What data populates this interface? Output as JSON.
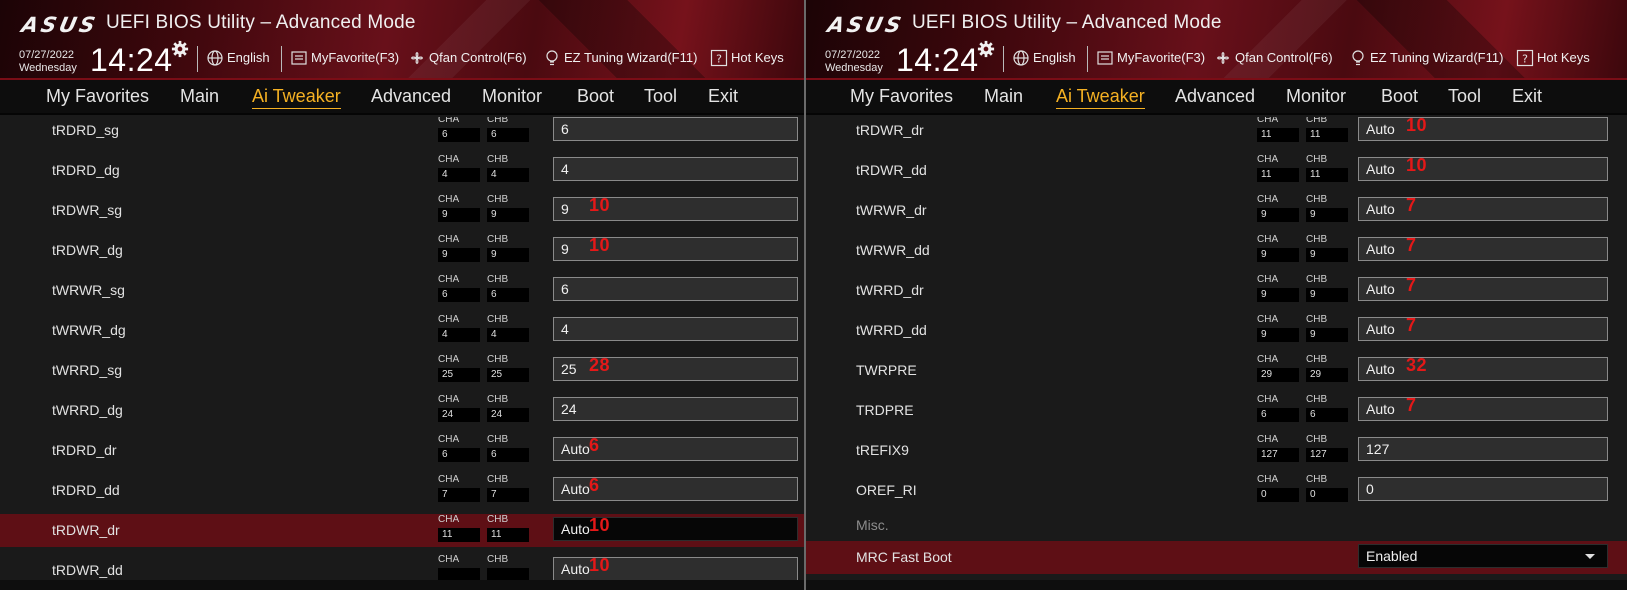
{
  "header": {
    "logo": "ASUS",
    "title": "UEFI BIOS Utility – Advanced Mode",
    "date": "07/27/2022",
    "day": "Wednesday",
    "time": "14:24",
    "language": "English",
    "my_favorite": "MyFavorite(F3)",
    "qfan": "Qfan Control(F6)",
    "ez_tuning": "EZ Tuning Wizard(F11)",
    "hot_keys": "Hot Keys"
  },
  "nav": [
    "My Favorites",
    "Main",
    "Ai Tweaker",
    "Advanced",
    "Monitor",
    "Boot",
    "Tool",
    "Exit"
  ],
  "active_tab": "Ai Tweaker",
  "colors": {
    "accent": "#f5b123",
    "header_red": "#68101a",
    "selected_row": "#5e0f15",
    "annotation": "#e41818"
  },
  "channel_labels": {
    "a": "CHA",
    "b": "CHB"
  },
  "left_panel": {
    "rows": [
      {
        "label": "tRDRD_sg",
        "cha": "6",
        "chb": "6",
        "value": "6",
        "note": ""
      },
      {
        "label": "tRDRD_dg",
        "cha": "4",
        "chb": "4",
        "value": "4",
        "note": ""
      },
      {
        "label": "tRDWR_sg",
        "cha": "9",
        "chb": "9",
        "value": "9",
        "note": "10"
      },
      {
        "label": "tRDWR_dg",
        "cha": "9",
        "chb": "9",
        "value": "9",
        "note": "10"
      },
      {
        "label": "tWRWR_sg",
        "cha": "6",
        "chb": "6",
        "value": "6",
        "note": ""
      },
      {
        "label": "tWRWR_dg",
        "cha": "4",
        "chb": "4",
        "value": "4",
        "note": ""
      },
      {
        "label": "tWRRD_sg",
        "cha": "25",
        "chb": "25",
        "value": "25",
        "note": "28"
      },
      {
        "label": "tWRRD_dg",
        "cha": "24",
        "chb": "24",
        "value": "24",
        "note": ""
      },
      {
        "label": "tRDRD_dr",
        "cha": "6",
        "chb": "6",
        "value": "Auto",
        "note": "6"
      },
      {
        "label": "tRDRD_dd",
        "cha": "7",
        "chb": "7",
        "value": "Auto",
        "note": "6"
      },
      {
        "label": "tRDWR_dr",
        "cha": "11",
        "chb": "11",
        "value": "Auto",
        "note": "10",
        "selected": true
      },
      {
        "label": "tRDWR_dd",
        "cha": "",
        "chb": "",
        "value": "Auto",
        "note": "10"
      }
    ]
  },
  "right_panel": {
    "rows": [
      {
        "label": "tRDWR_dr",
        "cha": "11",
        "chb": "11",
        "value": "Auto",
        "note": "10"
      },
      {
        "label": "tRDWR_dd",
        "cha": "11",
        "chb": "11",
        "value": "Auto",
        "note": "10"
      },
      {
        "label": "tWRWR_dr",
        "cha": "9",
        "chb": "9",
        "value": "Auto",
        "note": "7"
      },
      {
        "label": "tWRWR_dd",
        "cha": "9",
        "chb": "9",
        "value": "Auto",
        "note": "7"
      },
      {
        "label": "tWRRD_dr",
        "cha": "9",
        "chb": "9",
        "value": "Auto",
        "note": "7"
      },
      {
        "label": "tWRRD_dd",
        "cha": "9",
        "chb": "9",
        "value": "Auto",
        "note": "7"
      },
      {
        "label": "TWRPRE",
        "cha": "29",
        "chb": "29",
        "value": "Auto",
        "note": "32"
      },
      {
        "label": "TRDPRE",
        "cha": "6",
        "chb": "6",
        "value": "Auto",
        "note": "7"
      },
      {
        "label": "tREFIX9",
        "cha": "127",
        "chb": "127",
        "value": "127",
        "note": ""
      },
      {
        "label": "OREF_RI",
        "cha": "0",
        "chb": "0",
        "value": "0",
        "note": ""
      }
    ],
    "misc_label": "Misc.",
    "mrc_fast_boot": {
      "label": "MRC Fast Boot",
      "value": "Enabled"
    }
  }
}
